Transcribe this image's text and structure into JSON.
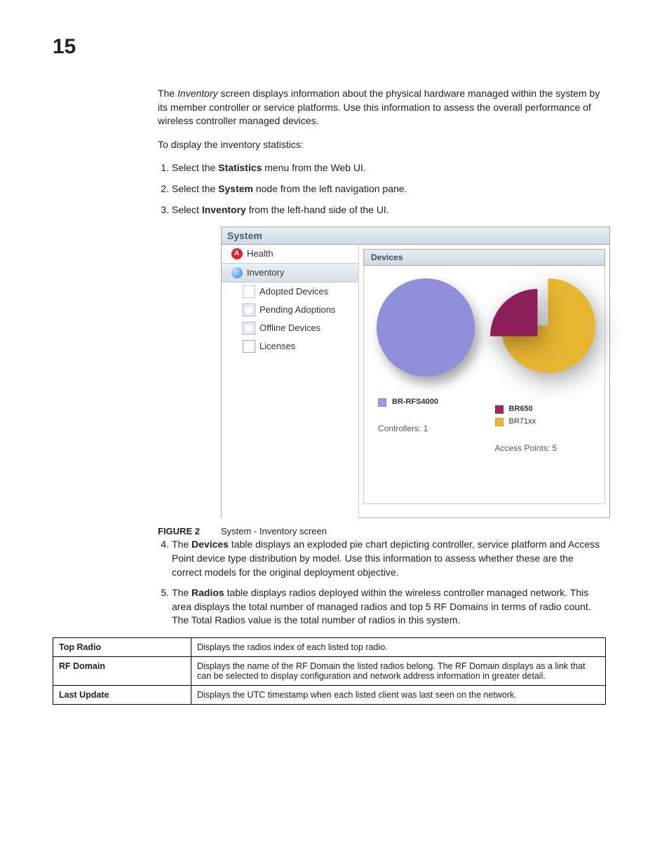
{
  "chapter_number": "15",
  "intro": {
    "p1_prefix": "The ",
    "p1_italic": "Inventory",
    "p1_rest": " screen displays information about the physical hardware managed within the system by its member controller or service platforms. Use this information to assess the overall performance of wireless controller managed devices.",
    "p2": "To display the inventory statistics:"
  },
  "steps_a": [
    {
      "pre": "Select the ",
      "bold": "Statistics",
      "post": " menu from the Web UI."
    },
    {
      "pre": "Select the ",
      "bold": "System",
      "post": " node from the left navigation pane."
    },
    {
      "pre": "Select ",
      "bold": "Inventory",
      "post": " from the left-hand side of the UI."
    }
  ],
  "screenshot": {
    "title": "System",
    "nav": [
      {
        "label": "Health",
        "icon": "heart-icon",
        "cls": "ico-heart",
        "sub": false,
        "sel": false
      },
      {
        "label": "Inventory",
        "icon": "globe-icon",
        "cls": "ico-globe",
        "sub": false,
        "sel": true
      },
      {
        "label": "Adopted Devices",
        "icon": "adopted-icon",
        "cls": "ico-dots",
        "sub": true,
        "sel": false
      },
      {
        "label": "Pending Adoptions",
        "icon": "pending-icon",
        "cls": "ico-box",
        "sub": true,
        "sel": false
      },
      {
        "label": "Offline Devices",
        "icon": "offline-icon",
        "cls": "ico-box",
        "sub": true,
        "sel": false
      },
      {
        "label": "Licenses",
        "icon": "licenses-icon",
        "cls": "ico-list",
        "sub": true,
        "sel": false
      }
    ],
    "panel_title": "Devices",
    "legend_left": [
      {
        "color": "#9a9ae0",
        "label": "BR-RFS4000"
      }
    ],
    "legend_right": [
      {
        "color": "#9a2a63",
        "label": "BR650"
      },
      {
        "color": "#e6b531",
        "label": "BR71xx"
      }
    ],
    "count_left": "Controllers: 1",
    "count_right": "Access Points: 5"
  },
  "figure": {
    "label": "FIGURE 2",
    "caption": "System - Inventory screen"
  },
  "steps_b": [
    {
      "pre": "The ",
      "bold": "Devices",
      "post": " table displays an exploded pie chart depicting controller, service platform and Access Point device type distribution by model. Use this information to assess whether these are the correct models for the original deployment objective."
    },
    {
      "pre": "The ",
      "bold": "Radios",
      "post": " table displays radios deployed within the wireless controller managed network. This area displays the total number of managed radios and top 5 RF Domains in terms of radio count. The Total Radios value is the total number of radios in this system."
    }
  ],
  "table": [
    {
      "h": "Top Radio",
      "d": "Displays the radios index of each listed top radio."
    },
    {
      "h": "RF Domain",
      "d": "Displays the name of the RF Domain the listed radios belong. The RF Domain displays as a link that can be selected to display configuration and network address information in greater detail."
    },
    {
      "h": "Last Update",
      "d": "Displays the UTC timestamp when each listed client was last seen on the network."
    }
  ],
  "chart_data": [
    {
      "type": "pie",
      "title": "Controllers",
      "series": [
        {
          "name": "BR-RFS4000",
          "value": 1,
          "color": "#8f8fd9"
        }
      ],
      "total_label": "Controllers: 1"
    },
    {
      "type": "pie",
      "title": "Access Points",
      "series": [
        {
          "name": "BR650",
          "value": 1,
          "color": "#8e1e5a"
        },
        {
          "name": "BR71xx",
          "value": 4,
          "color": "#e6b531"
        }
      ],
      "total_label": "Access Points: 5"
    }
  ]
}
